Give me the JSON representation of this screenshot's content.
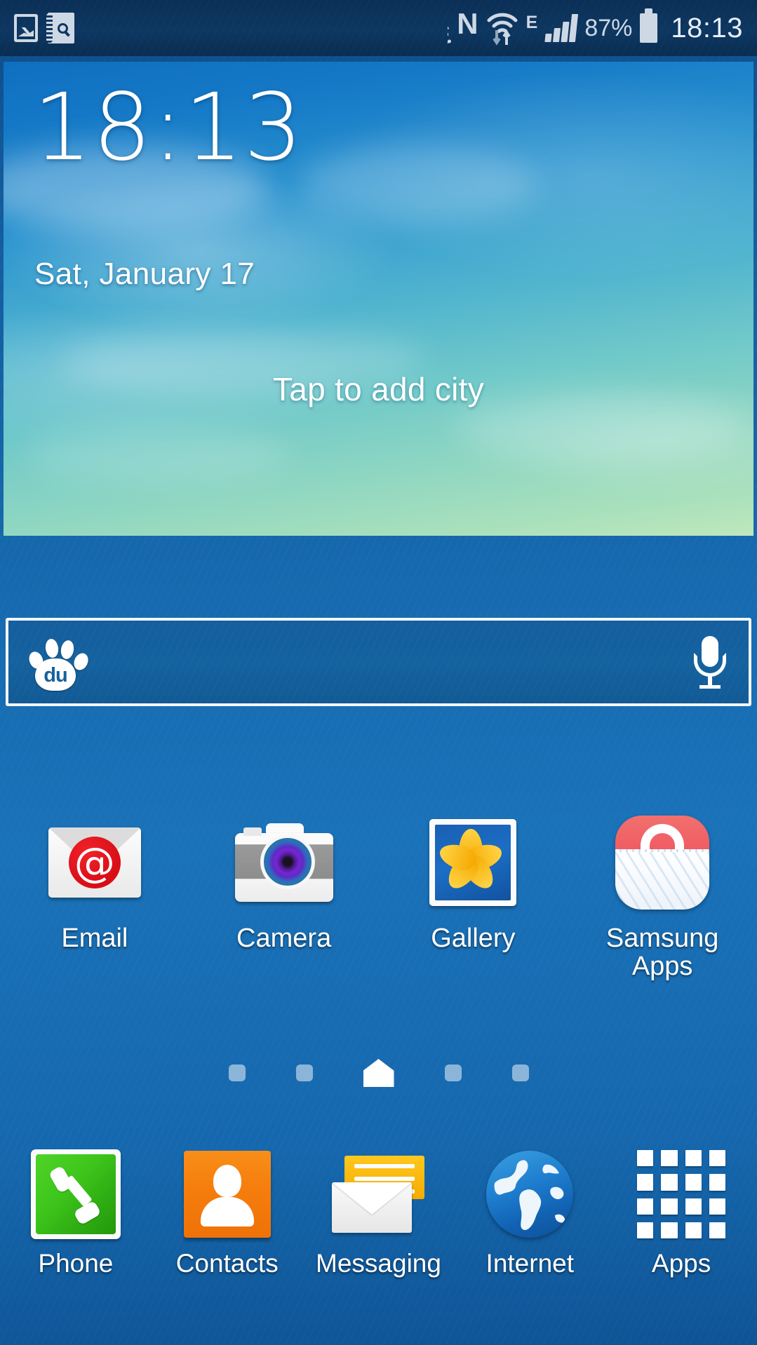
{
  "status_bar": {
    "left_icons": [
      {
        "name": "screenshot-icon",
        "label": "Screenshot capture"
      },
      {
        "name": "s-finder-icon",
        "label": "S Finder"
      }
    ],
    "right_icons": [
      {
        "name": "nfc-icon",
        "label": "NFC"
      },
      {
        "name": "wifi-icon",
        "label": "Wi-Fi with data transfer"
      },
      {
        "name": "network-type-icon",
        "label": "E"
      },
      {
        "name": "signal-bars-icon",
        "label": "Signal strength"
      }
    ],
    "network_type": "E",
    "battery_percent": "87%",
    "clock": "18:13"
  },
  "weather_widget": {
    "time": "18:13",
    "date": "Sat, January 17",
    "add_city_prompt": "Tap to add city"
  },
  "search_bar": {
    "provider": "Baidu",
    "logo_text": "du",
    "query_value": "",
    "placeholder": "",
    "mic_icon": "microphone-icon"
  },
  "apps": [
    {
      "label": "Email",
      "icon": "email-icon"
    },
    {
      "label": "Camera",
      "icon": "camera-icon"
    },
    {
      "label": "Gallery",
      "icon": "gallery-icon"
    },
    {
      "label": "Samsung Apps",
      "icon": "samsung-apps-icon"
    }
  ],
  "page_indicator": {
    "total_pages": 5,
    "current_page": 3,
    "home_page_index": 3
  },
  "dock": [
    {
      "label": "Phone",
      "icon": "phone-icon"
    },
    {
      "label": "Contacts",
      "icon": "contacts-icon"
    },
    {
      "label": "Messaging",
      "icon": "messaging-icon"
    },
    {
      "label": "Internet",
      "icon": "internet-icon"
    },
    {
      "label": "Apps",
      "icon": "apps-grid-icon"
    }
  ],
  "colors": {
    "wallpaper_blue": "#1668ad",
    "status_bar_blue": "#0d3761",
    "status_icon_grey": "#ced8e4",
    "email_red": "#d80d16",
    "contacts_orange": "#f57d0c",
    "phone_green": "#3ec61c",
    "messaging_yellow": "#f5ab00",
    "internet_blue": "#1f7fd0",
    "samsung_apps_red": "#ef5a62",
    "gallery_yellow": "#f5a800",
    "text_white": "#ffffff"
  }
}
